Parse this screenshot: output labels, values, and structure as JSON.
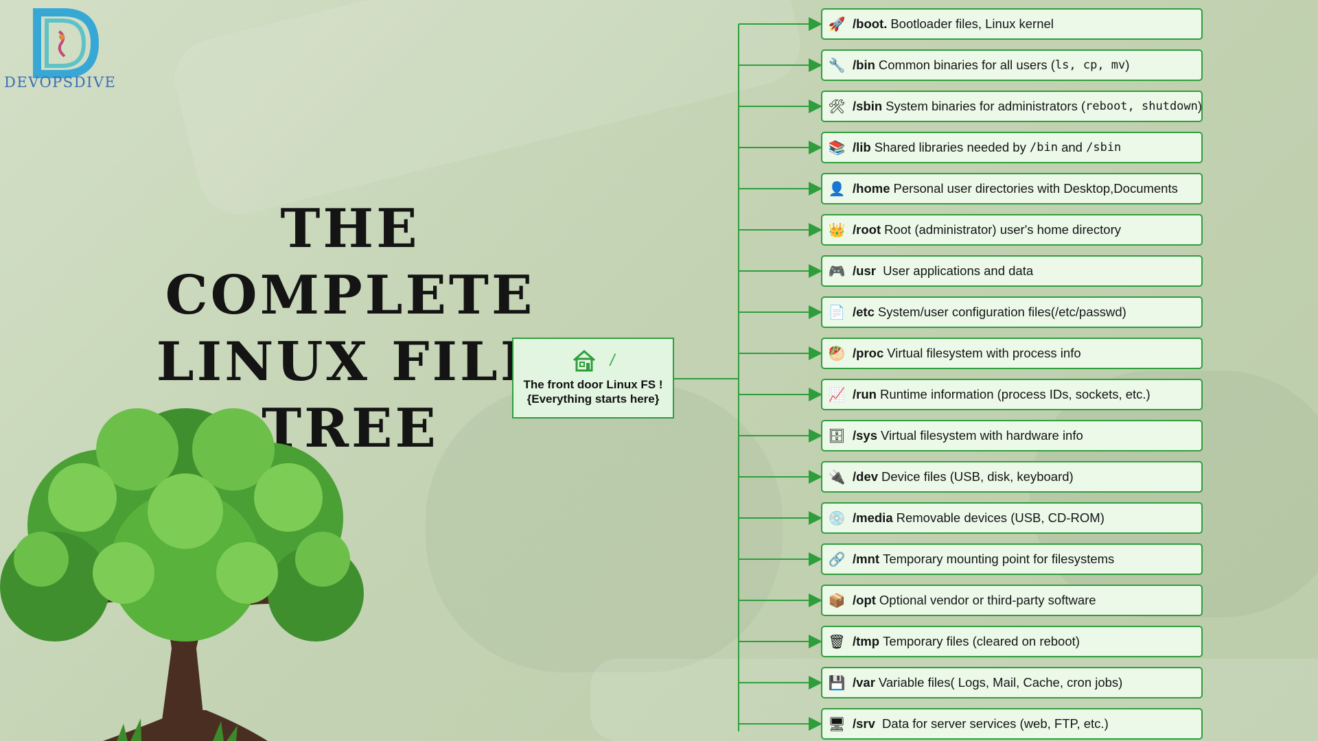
{
  "brand": {
    "name": "DEVOPSDIVE",
    "logo_letter": "D",
    "logo_icon": "dragon-swirl-logo"
  },
  "title": {
    "line1": "THE COMPLETE",
    "line2": "LINUX FILE",
    "line3": "TREE"
  },
  "root": {
    "symbol": "/",
    "line1": "The front door Linux FS !",
    "line2": "{Everything starts here}",
    "icon": "house-icon"
  },
  "colors": {
    "accent_green": "#2e9e3c",
    "box_fill": "#ecf9e9",
    "title": "#141414",
    "logo_blue": "#3b6fb5"
  },
  "directories": [
    {
      "name": "/boot.",
      "desc": "Bootloader files, Linux kernel",
      "icon": "rocket-icon",
      "glyph": "🚀"
    },
    {
      "name": "/bin",
      "desc": "Common binaries for all users (",
      "code": "ls, cp, mv",
      "tail": ")",
      "icon": "wrench-icon",
      "glyph": "🔧"
    },
    {
      "name": "/sbin",
      "desc": "System binaries for administrators (",
      "code": "reboot, shutdown",
      "tail": ")",
      "icon": "hammer-wrench-icon",
      "glyph": "🛠"
    },
    {
      "name": "/lib",
      "desc": "Shared libraries needed by ",
      "code": "/bin",
      "mid": " and ",
      "code2": "/sbin",
      "icon": "books-icon",
      "glyph": "📚"
    },
    {
      "name": "/home",
      "desc": "Personal user directories with Desktop,Documents",
      "icon": "user-icon",
      "glyph": "👤"
    },
    {
      "name": "/root",
      "desc": "Root (administrator) user's home directory",
      "icon": "crown-icon",
      "glyph": "👑"
    },
    {
      "name": "/usr",
      "desc": " User applications and data",
      "icon": "gamepad-icon",
      "glyph": "🎮"
    },
    {
      "name": "/etc",
      "desc": "System/user configuration files(/etc/passwd)",
      "icon": "document-icon",
      "glyph": "📄"
    },
    {
      "name": "/proc",
      "desc": "Virtual filesystem with process info",
      "icon": "processor-icon",
      "glyph": "🥙"
    },
    {
      "name": "/run",
      "desc": "Runtime information (process IDs, sockets, etc.)",
      "icon": "chart-monitor-icon",
      "glyph": "📈"
    },
    {
      "name": "/sys",
      "desc": "Virtual filesystem with hardware info",
      "icon": "server-icon",
      "glyph": "🗄"
    },
    {
      "name": "/dev",
      "desc": "Device files (USB, disk, keyboard)",
      "icon": "plug-icon",
      "glyph": "🔌"
    },
    {
      "name": "/media",
      "desc": "Removable devices (USB, CD-ROM)",
      "icon": "disc-icon",
      "glyph": "💿"
    },
    {
      "name": "/mnt",
      "desc": "Temporary mounting point for filesystems",
      "icon": "link-icon",
      "glyph": "🔗"
    },
    {
      "name": "/opt",
      "desc": "Optional vendor or third-party software",
      "icon": "package-icon",
      "glyph": "📦"
    },
    {
      "name": "/tmp",
      "desc": "Temporary files (cleared on reboot)",
      "icon": "trash-icon",
      "glyph": "🗑"
    },
    {
      "name": "/var",
      "desc": "Variable files( Logs, Mail, Cache, cron jobs)",
      "icon": "floppy-disk-icon",
      "glyph": "💾"
    },
    {
      "name": "/srv",
      "desc": " Data for server services (web, FTP, etc.)",
      "icon": "server-box-icon",
      "glyph": "🖥"
    }
  ]
}
